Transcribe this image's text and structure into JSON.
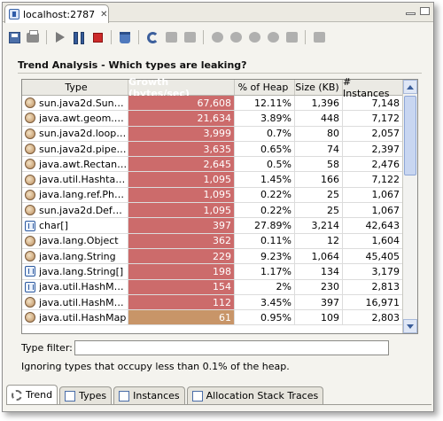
{
  "window": {
    "tab_title": "localhost:2787",
    "tab_close": "✕"
  },
  "toolbar": {
    "icons": [
      "save-icon",
      "print-icon",
      "run-icon",
      "pause-icon",
      "stop-icon",
      "run-gc-icon",
      "refresh-icon",
      "snapshot-icon",
      "export-icon",
      "zoom-in-icon",
      "zoom-out-icon",
      "zoom-fit-icon",
      "zoom-reset-icon",
      "zoom-select-icon",
      "options-icon"
    ]
  },
  "panel": {
    "title": "Trend Analysis - Which types are leaking?",
    "columns": {
      "type": "Type",
      "growth": "Growth (bytes/sec)",
      "heap": "% of Heap",
      "size": "Size (KB)",
      "instances": "# Instances"
    },
    "rows": [
      {
        "icon": "class",
        "type": "sun.java2d.SunG…",
        "growth": "67,608",
        "heap": "12.11%",
        "size": "1,396",
        "instances": "7,148"
      },
      {
        "icon": "class",
        "type": "java.awt.geom.A…",
        "growth": "21,634",
        "heap": "3.89%",
        "size": "448",
        "instances": "7,172"
      },
      {
        "icon": "class",
        "type": "sun.java2d.loops…",
        "growth": "3,999",
        "heap": "0.7%",
        "size": "80",
        "instances": "2,057"
      },
      {
        "icon": "class",
        "type": "sun.java2d.pipe.…",
        "growth": "3,635",
        "heap": "0.65%",
        "size": "74",
        "instances": "2,397"
      },
      {
        "icon": "class",
        "type": "java.awt.Rectangle",
        "growth": "2,645",
        "heap": "0.5%",
        "size": "58",
        "instances": "2,476"
      },
      {
        "icon": "class",
        "type": "java.util.Hashtabl…",
        "growth": "1,095",
        "heap": "1.45%",
        "size": "166",
        "instances": "7,122"
      },
      {
        "icon": "class",
        "type": "java.lang.ref.Pha…",
        "growth": "1,095",
        "heap": "0.22%",
        "size": "25",
        "instances": "1,067"
      },
      {
        "icon": "class",
        "type": "sun.java2d.Defa…",
        "growth": "1,095",
        "heap": "0.22%",
        "size": "25",
        "instances": "1,067"
      },
      {
        "icon": "array",
        "type": "char[]",
        "growth": "397",
        "heap": "27.89%",
        "size": "3,214",
        "instances": "42,643"
      },
      {
        "icon": "class",
        "type": "java.lang.Object",
        "growth": "362",
        "heap": "0.11%",
        "size": "12",
        "instances": "1,604"
      },
      {
        "icon": "class",
        "type": "java.lang.String",
        "growth": "229",
        "heap": "9.23%",
        "size": "1,064",
        "instances": "45,405"
      },
      {
        "icon": "array",
        "type": "java.lang.String[]",
        "growth": "198",
        "heap": "1.17%",
        "size": "134",
        "instances": "3,179"
      },
      {
        "icon": "array",
        "type": "java.util.HashMa…",
        "growth": "154",
        "heap": "2%",
        "size": "230",
        "instances": "2,813"
      },
      {
        "icon": "class",
        "type": "java.util.HashMa…",
        "growth": "112",
        "heap": "3.45%",
        "size": "397",
        "instances": "16,971"
      },
      {
        "icon": "class",
        "type": "java.util.HashMap",
        "growth": "61",
        "heap": "0.95%",
        "size": "109",
        "instances": "2,803"
      }
    ],
    "colors": {
      "growth_high": "#cc6b6b",
      "growth_low": "#c89568"
    },
    "filter_label": "Type filter:",
    "filter_value": "",
    "note": "Ignoring types that occupy less than 0.1% of the heap."
  },
  "bottom_tabs": [
    {
      "label": "Trend",
      "icon": "trend-icon",
      "active": true
    },
    {
      "label": "Types",
      "icon": "types-icon",
      "active": false
    },
    {
      "label": "Instances",
      "icon": "instances-icon",
      "active": false
    },
    {
      "label": "Allocation Stack Traces",
      "icon": "stack-traces-icon",
      "active": false
    }
  ]
}
